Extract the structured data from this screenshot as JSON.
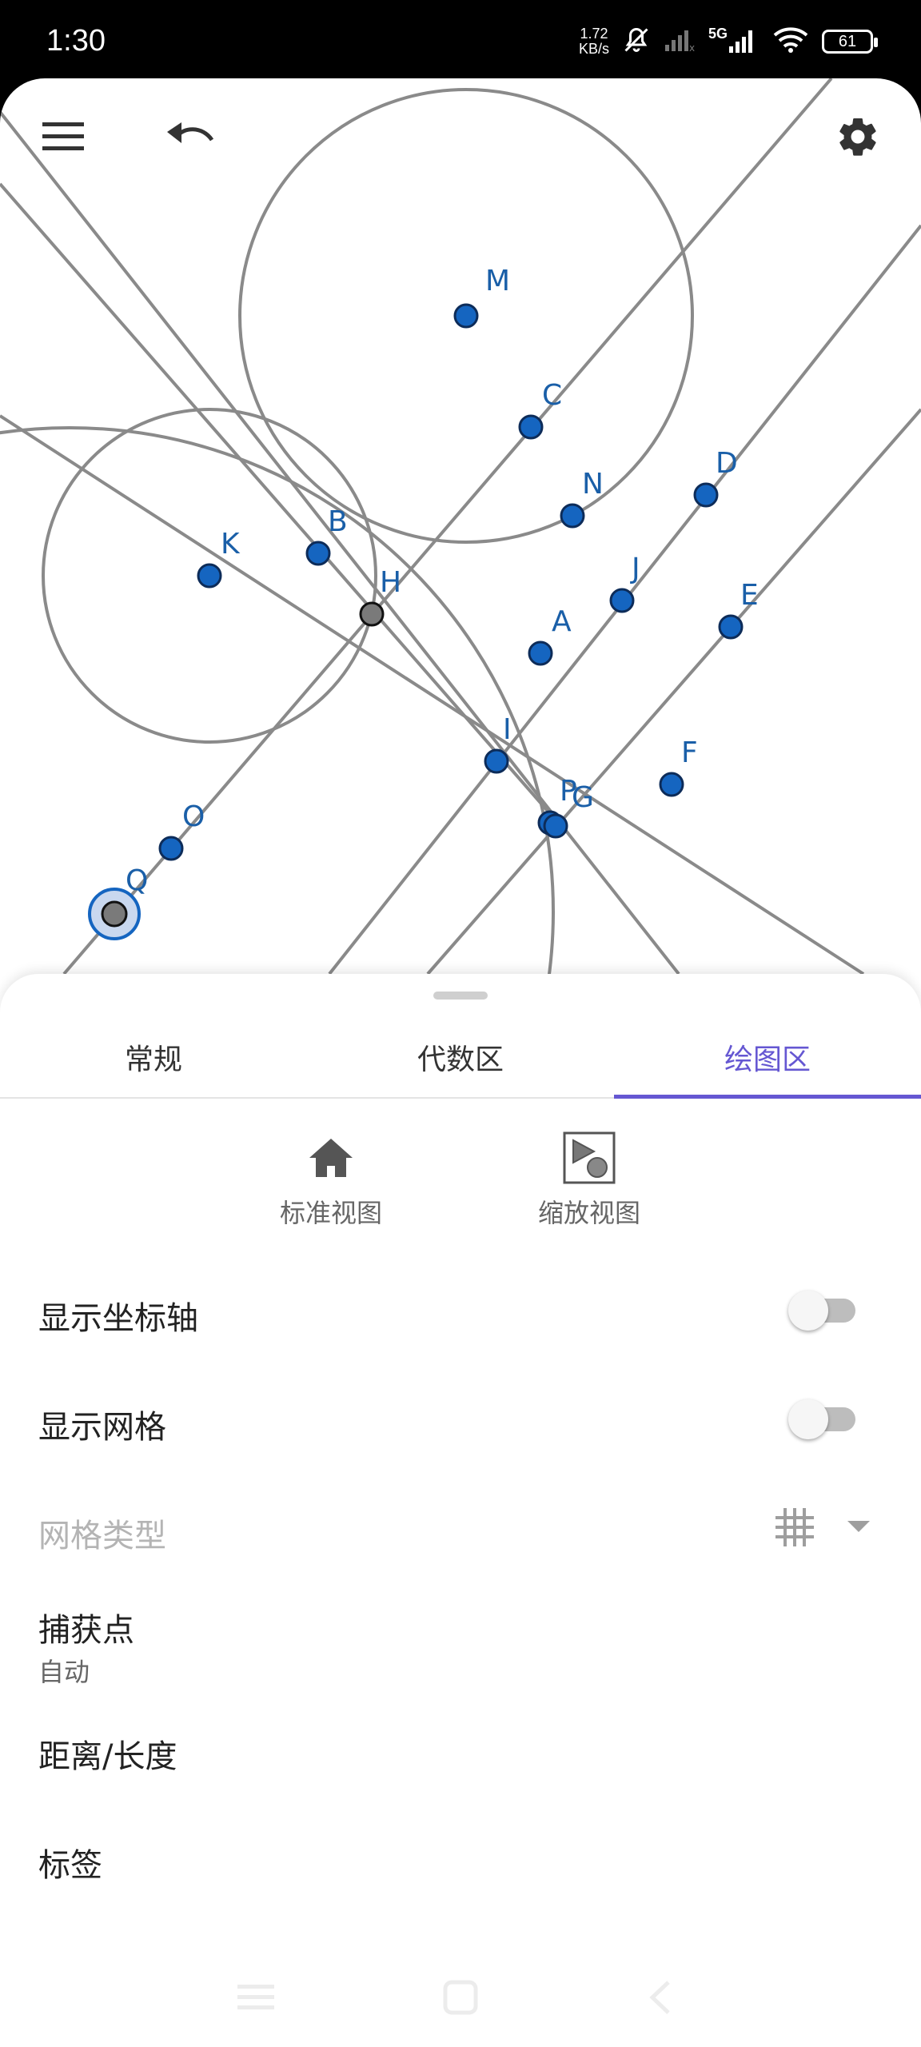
{
  "status_bar": {
    "time": "1:30",
    "net_speed_value": "1.72",
    "net_speed_unit": "KB/s",
    "network_type": "5G",
    "battery": "61"
  },
  "canvas": {
    "points": [
      {
        "label": "M"
      },
      {
        "label": "C"
      },
      {
        "label": "N"
      },
      {
        "label": "D"
      },
      {
        "label": "K"
      },
      {
        "label": "B"
      },
      {
        "label": "H"
      },
      {
        "label": "J"
      },
      {
        "label": "A"
      },
      {
        "label": "E"
      },
      {
        "label": "I"
      },
      {
        "label": "F"
      },
      {
        "label": "P"
      },
      {
        "label": "G"
      },
      {
        "label": "O"
      },
      {
        "label": "Q"
      }
    ]
  },
  "tabs": [
    {
      "label": "常规"
    },
    {
      "label": "代数区"
    },
    {
      "label": "绘图区"
    }
  ],
  "view_buttons": {
    "standard_view": "标准视图",
    "zoom_view": "缩放视图"
  },
  "settings": {
    "show_axes": {
      "label": "显示坐标轴",
      "checked": false
    },
    "show_grid": {
      "label": "显示网格",
      "checked": false
    },
    "grid_type": {
      "label": "网格类型",
      "enabled": false
    },
    "point_capturing": {
      "label": "捕获点",
      "value": "自动"
    },
    "distance": {
      "label": "距离/长度"
    },
    "labeling": {
      "label": "标签"
    }
  },
  "colors": {
    "accent": "#6557d2",
    "point_blue": "#1565c0",
    "line_gray": "#8a8a8a"
  }
}
